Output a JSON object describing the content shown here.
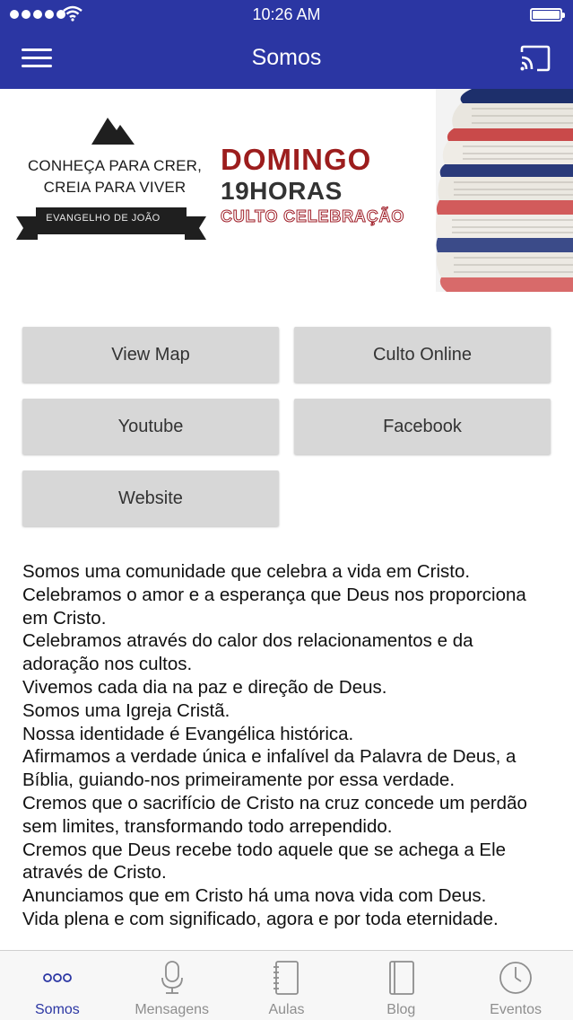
{
  "status_bar": {
    "time": "10:26 AM",
    "signal_icon": "signal-dots-icon",
    "wifi_icon": "wifi-icon",
    "battery_icon": "battery-icon"
  },
  "nav": {
    "title": "Somos",
    "menu_icon": "hamburger-menu-icon",
    "cast_icon": "cast-icon"
  },
  "banner": {
    "tagline_line1": "CONHEÇA PARA CRER,",
    "tagline_line2": "CREIA PARA VIVER",
    "ribbon": "EVANGELHO DE JOÃO",
    "day": "DOMINGO",
    "hour": "19HORAS",
    "service": "CULTO CELEBRAÇÃO"
  },
  "buttons": {
    "view_map": "View Map",
    "culto_online": "Culto Online",
    "youtube": "Youtube",
    "facebook": "Facebook",
    "website": "Website"
  },
  "description": [
    "Somos uma comunidade que celebra a vida em Cristo.",
    "Celebramos o amor e a esperança que Deus nos proporciona em Cristo.",
    "Celebramos através do calor dos relacionamentos e da adoração nos cultos.",
    "Vivemos cada dia na paz e direção de Deus.",
    "Somos uma Igreja Cristã.",
    "Nossa identidade é Evangélica histórica.",
    "Afirmamos a verdade única e infalível da Palavra de Deus, a Bíblia, guiando-nos primeiramente por essa verdade.",
    "Cremos que o sacrifício de Cristo na cruz concede um perdão sem limites, transformando todo arrependido.",
    "Cremos que Deus recebe todo aquele que se achega a Ele através de Cristo.",
    "Anunciamos que em Cristo há uma nova vida com Deus.",
    "Vida plena e com significado, agora e por toda eternidade."
  ],
  "tabs": [
    {
      "label": "Somos",
      "icon": "more-dots-icon",
      "active": true
    },
    {
      "label": "Mensagens",
      "icon": "microphone-icon",
      "active": false
    },
    {
      "label": "Aulas",
      "icon": "notebook-icon",
      "active": false
    },
    {
      "label": "Blog",
      "icon": "book-icon",
      "active": false
    },
    {
      "label": "Eventos",
      "icon": "clock-icon",
      "active": false
    }
  ],
  "colors": {
    "accent": "#2b36a3",
    "button_bg": "#d7d7d7",
    "tab_inactive": "#8e8e8e"
  }
}
